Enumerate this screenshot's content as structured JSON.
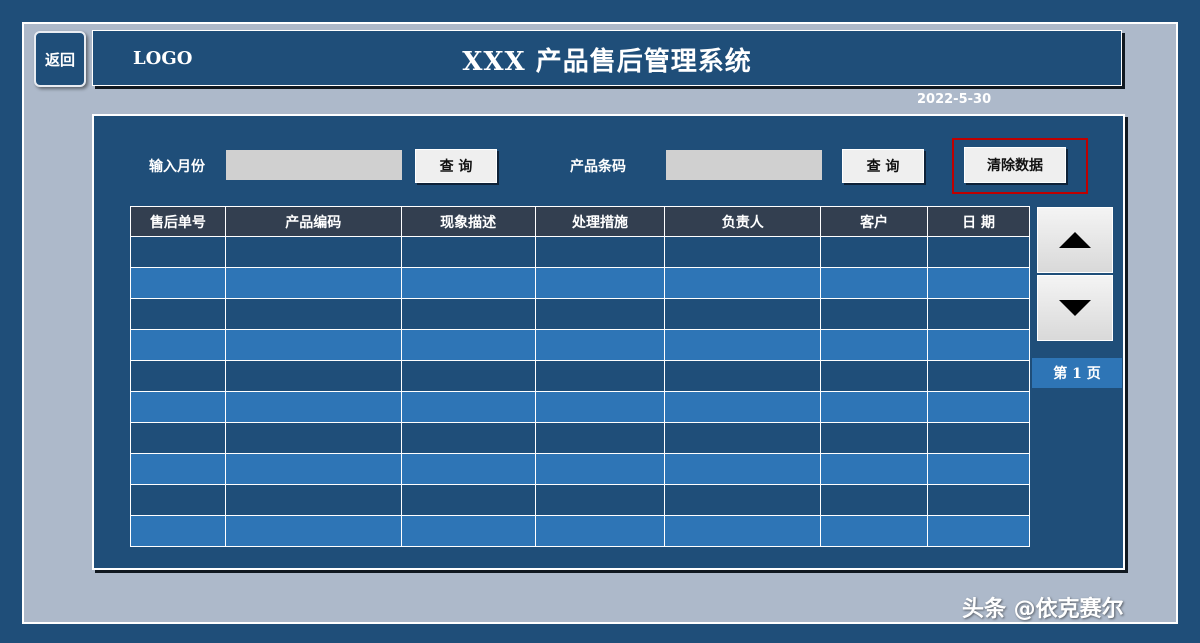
{
  "back_button": "返回",
  "header": {
    "logo": "LOGO",
    "title": "XXX 产品售后管理系统"
  },
  "date": "2022-5-30",
  "search": {
    "month_label": "输入月份",
    "month_value": "",
    "query_label": "查 询",
    "barcode_label": "产品条码",
    "barcode_value": "",
    "clear_label": "清除数据"
  },
  "table": {
    "columns": [
      "售后单号",
      "产品编码",
      "现象描述",
      "处理措施",
      "负责人",
      "客户",
      "日 期"
    ],
    "row_count": 10
  },
  "pager": {
    "page_label": "第 1 页"
  },
  "colors": {
    "background": "#1f4e79",
    "frame": "#adb9ca",
    "header_row": "#333f50",
    "row_light": "#2e75b6",
    "clear_outline": "#c00000"
  },
  "icons": {
    "up": "triangle-up-icon",
    "down": "triangle-down-icon"
  },
  "watermark": "头条 @依克赛尔"
}
